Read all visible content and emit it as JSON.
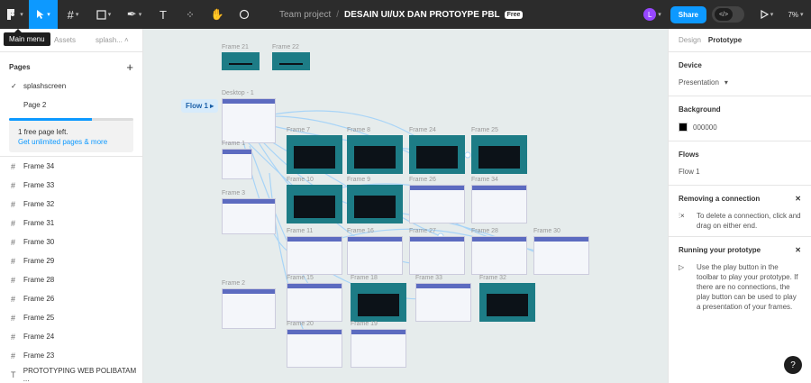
{
  "toolbar": {
    "main_menu_tooltip": "Main menu",
    "team": "Team project",
    "separator": "/",
    "file_name": "DESAIN UI/UX DAN PROTOYPE PBL",
    "plan_badge": "Free",
    "avatar_initial": "L",
    "share_label": "Share",
    "dev_mode_label": "</>",
    "zoom": "7%"
  },
  "left_panel": {
    "tabs": [
      "Assets",
      "splash..."
    ],
    "pages_title": "Pages",
    "add_label": "+",
    "pages": [
      {
        "label": "splashscreen",
        "current": true
      },
      {
        "label": "Page 2",
        "current": false
      }
    ],
    "free_notice": "1 free page left.",
    "free_link": "Get unlimited pages & more",
    "free_progress": 0.67,
    "layers": [
      "Frame 34",
      "Frame 33",
      "Frame 32",
      "Frame 31",
      "Frame 30",
      "Frame 29",
      "Frame 28",
      "Frame 26",
      "Frame 25",
      "Frame 24",
      "Frame 23",
      "PROTOTYPING WEB POLIBATAM ..."
    ]
  },
  "canvas": {
    "flow_label": "Flow 1",
    "frame_labels": {
      "f21": "Frame 21",
      "f22": "Frame 22",
      "desk": "Desktop - 1",
      "f7": "Frame 7",
      "f8": "Frame 8",
      "f24": "Frame 24",
      "f25": "Frame 25",
      "f1": "Frame 1",
      "f10": "Frame 10",
      "f9": "Frame 9",
      "f26": "Frame 26",
      "f34": "Frame 34",
      "f3": "Frame 3",
      "f11": "Frame 11",
      "f16": "Frame 16",
      "f27": "Frame 27",
      "f28": "Frame 28",
      "f30": "Frame 30",
      "f2": "Frame 2",
      "f15": "Frame 15",
      "f18": "Frame 18",
      "f33": "Frame 33",
      "f32": "Frame 32",
      "f20": "Frame 20",
      "f19": "Frame 19"
    }
  },
  "right_panel": {
    "tabs": [
      "Design",
      "Prototype"
    ],
    "device_title": "Device",
    "device_value": "Presentation",
    "background_title": "Background",
    "background_value": "000000",
    "background_color": "#000000",
    "flows_title": "Flows",
    "flow_item": "Flow 1",
    "removing_title": "Removing a connection",
    "removing_body": "To delete a connection, click and drag on either end.",
    "running_title": "Running your prototype",
    "running_body": "Use the play button in the toolbar to play your prototype. If there are no connections, the play button can be used to play a presentation of your frames.",
    "help_label": "?"
  },
  "colors": {
    "accent": "#0d99ff",
    "toolbar_bg": "#2c2c2c",
    "frame_teal": "#1d7c86"
  }
}
